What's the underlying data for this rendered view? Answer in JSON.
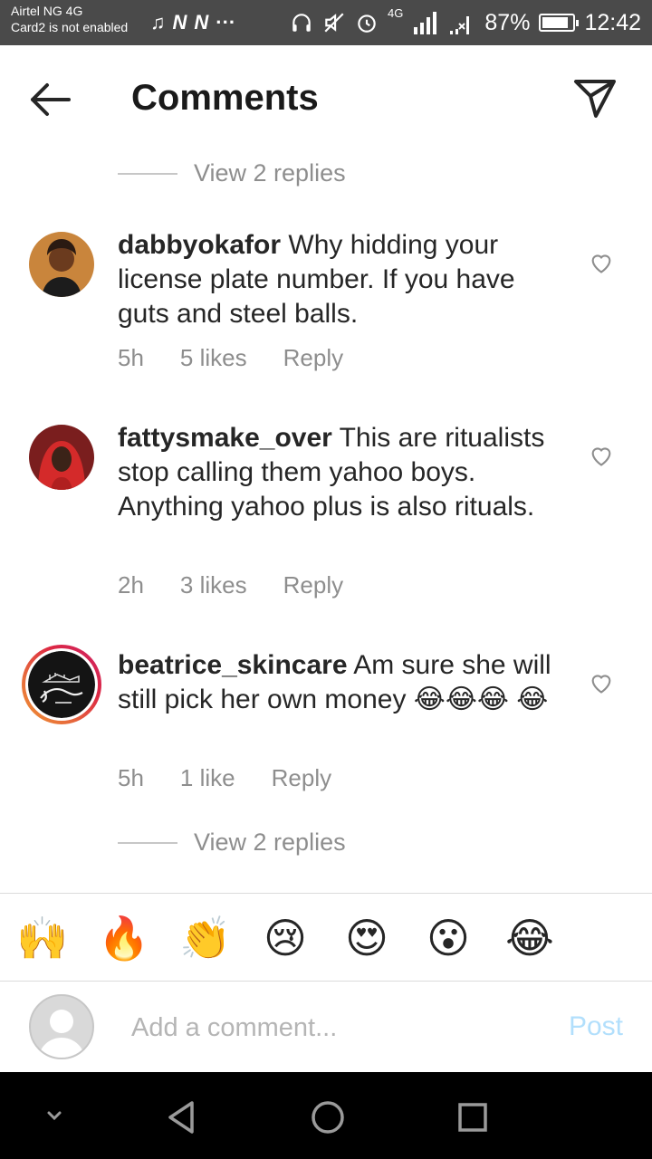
{
  "status_bar": {
    "carrier_line1": "Airtel NG 4G",
    "carrier_line2": "Card2 is not enabled",
    "notif_icons": [
      "music-icon",
      "n-app-icon",
      "n-app-icon",
      "more-notifications-icon"
    ],
    "network": "4G",
    "battery": "87%",
    "battery_level": 0.87,
    "time": "12:42"
  },
  "header": {
    "title": "Comments"
  },
  "view_replies_top": "View 2 replies",
  "comments": [
    {
      "username": "dabbyokafor",
      "text": "Why hidding your license plate number. If you have guts and steel balls. ",
      "time": "5h",
      "likes": "5 likes",
      "reply": "Reply"
    },
    {
      "username": "fattysmake_over",
      "text": "This are ritualists stop calling them yahoo boys. Anything yahoo plus is also rituals.",
      "time": "2h",
      "likes": "3 likes",
      "reply": "Reply"
    },
    {
      "username": "beatrice_skincare",
      "text": "Am sure she will still pick her own money 😂😂😂 😂",
      "time": "5h",
      "likes": "1 like",
      "reply": "Reply"
    }
  ],
  "view_replies_bottom": "View 2 replies",
  "emoji_bar": [
    "🙌",
    "🔥",
    "👏",
    "😢",
    "😍",
    "😮",
    "😂"
  ],
  "add_comment": {
    "placeholder": "Add a comment...",
    "post_label": "Post"
  },
  "colors": {
    "status_bar_bg": "#4a4a4a",
    "post_disabled": "#b2dffc",
    "muted_text": "#8e8e8e",
    "story_ring": "#e6683c"
  }
}
